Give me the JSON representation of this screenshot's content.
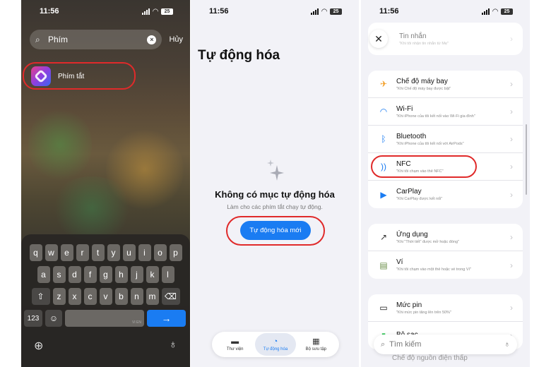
{
  "status": {
    "time": "11:56",
    "battery": "25"
  },
  "panel1": {
    "search": {
      "query": "Phím",
      "cancel": "Hủy"
    },
    "result": {
      "label": "Phím tắt"
    },
    "keyboard": {
      "row1": [
        "q",
        "w",
        "e",
        "r",
        "t",
        "y",
        "u",
        "i",
        "o",
        "p"
      ],
      "row2": [
        "a",
        "s",
        "d",
        "f",
        "g",
        "h",
        "j",
        "k",
        "l"
      ],
      "row3": [
        "z",
        "x",
        "c",
        "v",
        "b",
        "n",
        "m"
      ],
      "num_key": "123",
      "space_hint": "VI EN",
      "return_glyph": "→",
      "shift_glyph": "⇧",
      "delete_glyph": "⌫"
    }
  },
  "panel2": {
    "title": "Tự động hóa",
    "empty_title": "Không có mục tự động hóa",
    "empty_sub": "Làm cho các phím tắt chạy tự động.",
    "new_button": "Tự động hóa mới",
    "tabs": [
      {
        "label": "Thư viện",
        "icon": "▬"
      },
      {
        "label": "Tự động hóa",
        "icon": "◔"
      },
      {
        "label": "Bộ sưu tập",
        "icon": "▦"
      }
    ]
  },
  "panel3": {
    "top_item": {
      "title": "Tin nhắn",
      "desc": "\"Khi tôi nhận tin nhắn từ Mẹ\""
    },
    "group1": [
      {
        "title": "Chế độ máy bay",
        "desc": "\"Khi Chế độ máy bay được bật\"",
        "icon": "✈",
        "color": "#f29a1e"
      },
      {
        "title": "Wi-Fi",
        "desc": "\"Khi iPhone của tôi kết nối vào Wi-Fi gia đình\"",
        "icon": "◠",
        "color": "#1a7cf2"
      },
      {
        "title": "Bluetooth",
        "desc": "\"Khi iPhone của tôi kết nối với AirPods\"",
        "icon": "ᛒ",
        "color": "#1a7cf2"
      },
      {
        "title": "NFC",
        "desc": "\"Khi tôi chạm vào thẻ NFC\"",
        "icon": "))",
        "color": "#1a7cf2"
      },
      {
        "title": "CarPlay",
        "desc": "\"Khi CarPlay được kết nối\"",
        "icon": "▶",
        "color": "#1a7cf2"
      }
    ],
    "group2": [
      {
        "title": "Ứng dụng",
        "desc": "\"Khi \"Thời tiết\" được mở hoặc đóng\"",
        "icon": "↗",
        "color": "#333333"
      },
      {
        "title": "Ví",
        "desc": "\"Khi tôi chạm vào một thẻ hoặc vé trong Ví\"",
        "icon": "▤",
        "color": "#6b8f4a"
      }
    ],
    "group3": [
      {
        "title": "Mức pin",
        "desc": "\"Khi mức pin tăng lên trên 50%\"",
        "icon": "▭",
        "color": "#111111"
      },
      {
        "title": "Bộ sạc",
        "desc": "",
        "icon": "▮",
        "color": "#34c759"
      }
    ],
    "search_placeholder": "Tìm kiếm",
    "peek_item": "Chế độ nguồn điện thấp"
  }
}
